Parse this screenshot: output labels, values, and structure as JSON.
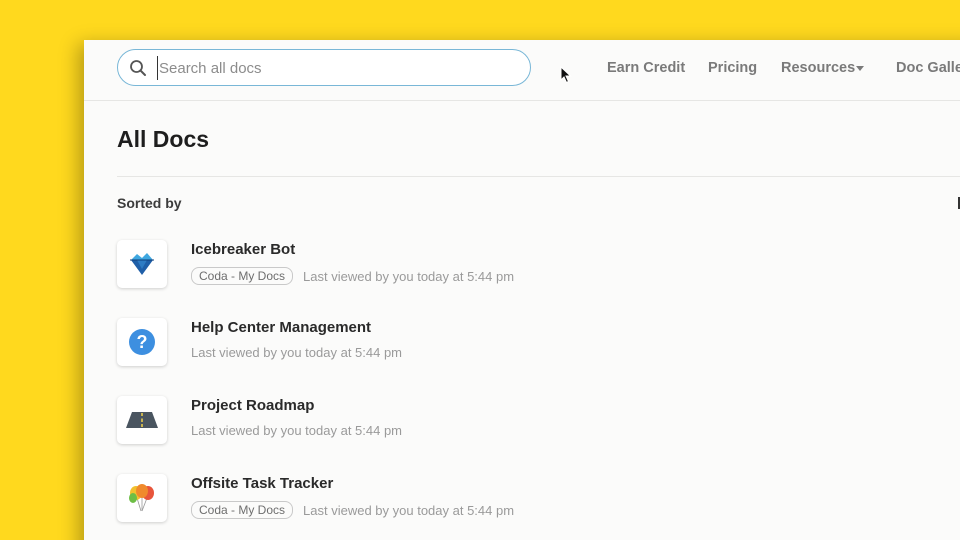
{
  "search": {
    "placeholder": "Search all docs",
    "value": ""
  },
  "nav": {
    "earn_credit": "Earn Credit",
    "pricing": "Pricing",
    "resources": "Resources",
    "doc_gallery": "Doc Galle"
  },
  "main": {
    "title": "All Docs",
    "sorted_by": "Sorted by",
    "docs": [
      {
        "title": "Icebreaker Bot",
        "tag": "Coda - My Docs",
        "viewed": "Last viewed by you today at 5:44 pm",
        "icon": "iceberg-icon"
      },
      {
        "title": "Help Center Management",
        "tag": "",
        "viewed": "Last viewed by you today at 5:44 pm",
        "icon": "question-icon"
      },
      {
        "title": "Project Roadmap",
        "tag": "",
        "viewed": "Last viewed by you today at 5:44 pm",
        "icon": "road-icon"
      },
      {
        "title": "Offsite Task Tracker",
        "tag": "Coda - My Docs",
        "viewed": "Last viewed by you today at 5:44 pm",
        "icon": "balloons-icon"
      }
    ]
  },
  "colors": {
    "background": "#FFD91E",
    "search_border": "#79B7D7",
    "nav_text": "#7A7A7A"
  }
}
